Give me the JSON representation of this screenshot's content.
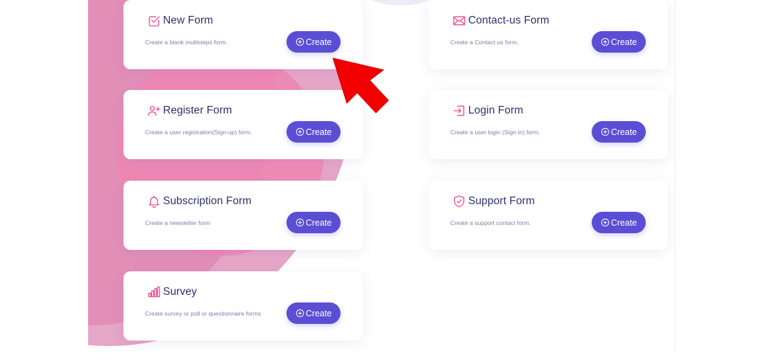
{
  "colors": {
    "accent": "#5a4fd4",
    "icon": "#f0488f",
    "title": "#2d2f6e",
    "description": "#7c7ea8",
    "annotation_arrow": "#f20000"
  },
  "cards": [
    {
      "id": "new-form",
      "title": "New Form",
      "description": "Create a blank multisteps form.",
      "button": "Create",
      "icon": "check-square-icon"
    },
    {
      "id": "contact-us-form",
      "title": "Contact-us Form",
      "description": "Create a Contact us form.",
      "button": "Create",
      "icon": "mail-icon"
    },
    {
      "id": "register-form",
      "title": "Register Form",
      "description": "Create a user registration(Sign-up) form.",
      "button": "Create",
      "icon": "user-plus-icon"
    },
    {
      "id": "login-form",
      "title": "Login Form",
      "description": "Create a user login (Sign-in) form.",
      "button": "Create",
      "icon": "login-icon"
    },
    {
      "id": "subscription-form",
      "title": "Subscription Form",
      "description": "Create a newsletter form",
      "button": "Create",
      "icon": "bell-icon"
    },
    {
      "id": "support-form",
      "title": "Support Form",
      "description": "Create a support contact form.",
      "button": "Create",
      "icon": "shield-check-icon"
    },
    {
      "id": "survey",
      "title": "Survey",
      "description": "Create survey or poll or questionnaire forms",
      "button": "Create",
      "icon": "bar-chart-icon"
    }
  ]
}
